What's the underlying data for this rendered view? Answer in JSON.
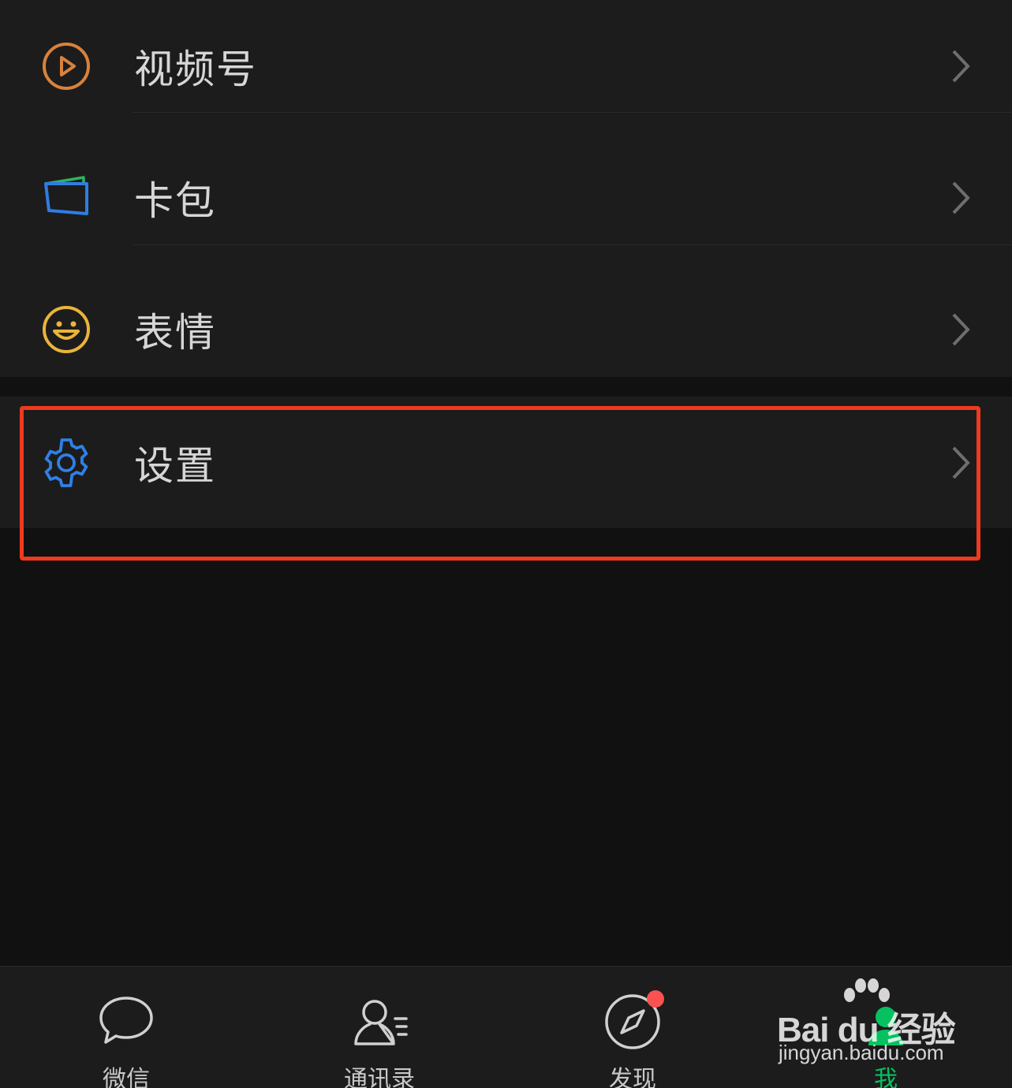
{
  "menu": {
    "items": [
      {
        "label": "视频号",
        "icon": "video-channel-icon",
        "color": "#d9823b"
      },
      {
        "label": "卡包",
        "icon": "card-wallet-icon",
        "color": "#2f7de1"
      },
      {
        "label": "表情",
        "icon": "smiley-icon",
        "color": "#e9b43a"
      }
    ],
    "settings": {
      "label": "设置",
      "icon": "gear-icon",
      "color": "#2f80e7"
    }
  },
  "highlight": {
    "color": "#ee3a1f"
  },
  "tabbar": {
    "tabs": [
      {
        "label": "微信",
        "icon": "chat-bubble-icon",
        "active": false
      },
      {
        "label": "通讯录",
        "icon": "contacts-icon",
        "active": false
      },
      {
        "label": "发现",
        "icon": "compass-icon",
        "active": false,
        "badge": true
      },
      {
        "label": "我",
        "icon": "person-icon",
        "active": true
      }
    ],
    "active_color": "#07c160",
    "badge_color": "#fa5151"
  },
  "watermark": {
    "brand": "Bai du 经验",
    "url": "jingyan.baidu.com"
  }
}
